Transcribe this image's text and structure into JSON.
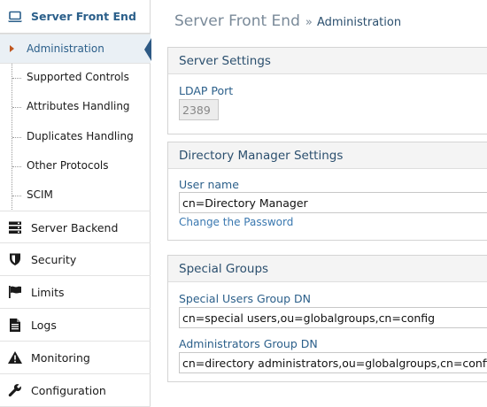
{
  "sidebar": {
    "sections": [
      {
        "label": "Server Front End",
        "icon": "laptop-icon",
        "active": true
      },
      {
        "label": "Server Backend",
        "icon": "server-icon",
        "active": false
      },
      {
        "label": "Security",
        "icon": "shield-icon",
        "active": false
      },
      {
        "label": "Limits",
        "icon": "flag-icon",
        "active": false
      },
      {
        "label": "Logs",
        "icon": "document-icon",
        "active": false
      },
      {
        "label": "Monitoring",
        "icon": "warning-icon",
        "active": false
      },
      {
        "label": "Configuration",
        "icon": "wrench-icon",
        "active": false
      }
    ],
    "subitems": [
      {
        "label": "Administration",
        "selected": true
      },
      {
        "label": "Supported Controls",
        "selected": false
      },
      {
        "label": "Attributes Handling",
        "selected": false
      },
      {
        "label": "Duplicates Handling",
        "selected": false
      },
      {
        "label": "Other Protocols",
        "selected": false
      },
      {
        "label": "SCIM",
        "selected": false
      }
    ]
  },
  "breadcrumb": {
    "title": "Server Front End",
    "separator": "»",
    "current": "Administration"
  },
  "panels": {
    "server_settings": {
      "header": "Server Settings",
      "ldap_port_label": "LDAP Port",
      "ldap_port_value": "2389"
    },
    "directory_manager": {
      "header": "Directory Manager Settings",
      "user_name_label": "User name",
      "user_name_value": "cn=Directory Manager",
      "change_password_link": "Change the Password"
    },
    "special_groups": {
      "header": "Special Groups",
      "special_users_label": "Special Users Group DN",
      "special_users_value": "cn=special users,ou=globalgroups,cn=config",
      "administrators_label": "Administrators Group DN",
      "administrators_value": "cn=directory administrators,ou=globalgroups,cn=config"
    }
  },
  "colors": {
    "accent": "#2b5f8a",
    "link": "#3a78b0",
    "caret": "#c0571f",
    "selection_notch": "#2e5a85"
  }
}
